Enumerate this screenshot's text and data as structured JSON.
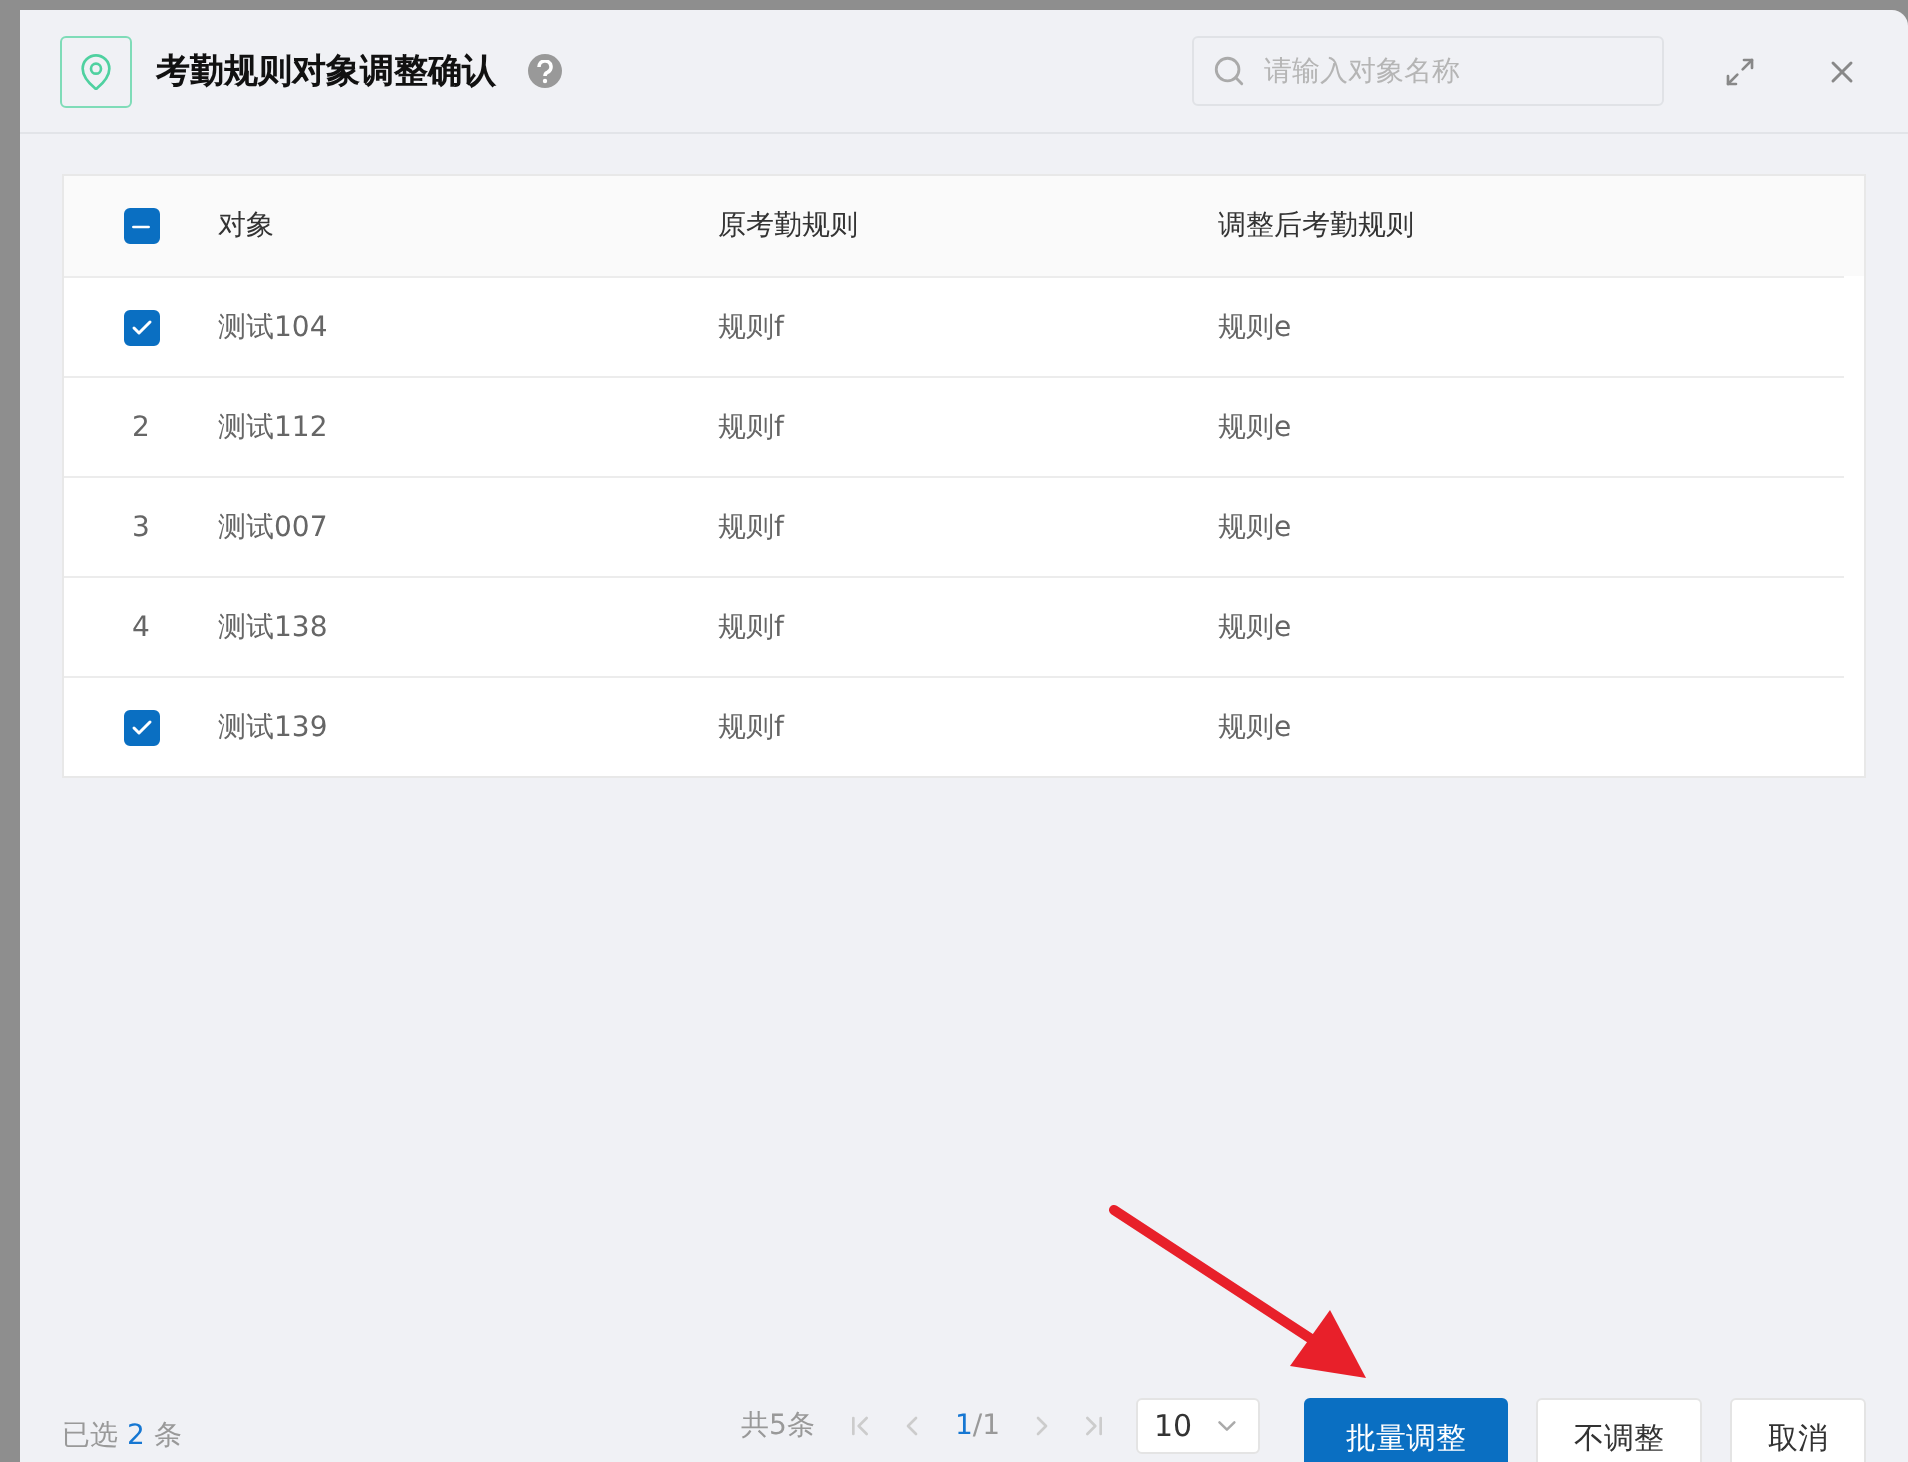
{
  "dialog": {
    "title": "考勤规则对象调整确认",
    "search": {
      "placeholder": "请输入对象名称"
    }
  },
  "table": {
    "select_all": {
      "indeterminate": true
    },
    "columns": [
      "对象",
      "原考勤规则",
      "调整后考勤规则"
    ],
    "rows": [
      {
        "checked": true,
        "cells": [
          "测试104",
          "规则f",
          "规则e"
        ]
      },
      {
        "index": "2",
        "checked": false,
        "cells": [
          "测试112",
          "规则f",
          "规则e"
        ]
      },
      {
        "index": "3",
        "checked": false,
        "cells": [
          "测试007",
          "规则f",
          "规则e"
        ]
      },
      {
        "index": "4",
        "checked": false,
        "cells": [
          "测试138",
          "规则f",
          "规则e"
        ]
      },
      {
        "checked": true,
        "cells": [
          "测试139",
          "规则f",
          "规则e"
        ]
      }
    ]
  },
  "footer": {
    "selected_prefix": "已选",
    "selected_count": "2",
    "selected_suffix": "条",
    "total": "共5条",
    "page_current": "1",
    "page_total": "/1",
    "page_size": "10",
    "buttons": [
      {
        "label": "批量调整",
        "kind": "primary"
      },
      {
        "label": "不调整",
        "kind": "default"
      },
      {
        "label": "取消",
        "kind": "default"
      }
    ]
  }
}
